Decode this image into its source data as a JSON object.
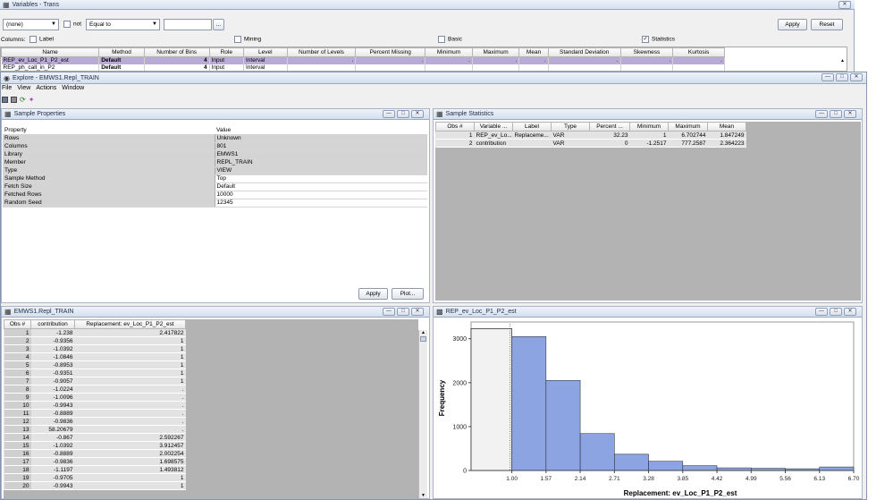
{
  "variables_window": {
    "title": "Variables - Trans",
    "filter": {
      "column_select": "(none)",
      "not_label": "not",
      "operator_select": "Equal to",
      "value": "",
      "ellipsis": "...",
      "apply": "Apply",
      "reset": "Reset"
    },
    "columns_label": "Columns:",
    "checkboxes": [
      {
        "label": "Label",
        "checked": false
      },
      {
        "label": "Mining",
        "checked": false
      },
      {
        "label": "Basic",
        "checked": false
      },
      {
        "label": "Statistics",
        "checked": true
      }
    ],
    "headers": [
      "Name",
      "Method",
      "Number of Bins",
      "Role",
      "Level",
      "Number of Levels",
      "Percent Missing",
      "Minimum",
      "Maximum",
      "Mean",
      "Standard Deviation",
      "Skewness",
      "Kurtosis"
    ],
    "rows": [
      [
        "REP_ev_Loc_P1_P2_est",
        "Default",
        "4",
        "Input",
        "Interval",
        ".",
        ".",
        ".",
        ".",
        ".",
        ".",
        ".",
        "."
      ],
      [
        "REP_ph_call_in_P2",
        "Default",
        "4",
        "Input",
        "Interval",
        "",
        "",
        "",
        "",
        "",
        "",
        "",
        ""
      ]
    ]
  },
  "explore_window": {
    "title": "Explore - EMWS1.Repl_TRAIN",
    "menu": [
      "File",
      "View",
      "Actions",
      "Window"
    ]
  },
  "sample_properties": {
    "title": "Sample Properties",
    "headers": [
      "Property",
      "Value"
    ],
    "rows": [
      [
        "Rows",
        "Unknown"
      ],
      [
        "Columns",
        "801"
      ],
      [
        "Library",
        "EMWS1"
      ],
      [
        "Member",
        "REPL_TRAIN"
      ],
      [
        "Type",
        "VIEW"
      ],
      [
        "Sample Method",
        "Top"
      ],
      [
        "Fetch Size",
        "Default"
      ],
      [
        "Fetched Rows",
        "10000"
      ],
      [
        "Random Seed",
        "12345"
      ]
    ],
    "apply": "Apply",
    "plot": "Plot..."
  },
  "sample_statistics": {
    "title": "Sample Statistics",
    "headers": [
      "Obs #",
      "Variable ...",
      "Label",
      "Type",
      "Percent ...",
      "Minimum",
      "Maximum",
      "Mean"
    ],
    "rows": [
      [
        "1",
        "REP_ev_Lo...",
        "Replaceme...",
        "VAR",
        "32.23",
        "1",
        "6.702744",
        "1.847249"
      ],
      [
        "2",
        "contribution",
        "",
        "VAR",
        "0",
        "-1.2517",
        "777.2587",
        "2.364223"
      ]
    ]
  },
  "data_table": {
    "title": "EMWS1.Repl_TRAIN",
    "headers": [
      "Obs #",
      "contribution",
      "Replacement: ev_Loc_P1_P2_est"
    ],
    "rows": [
      [
        "1",
        "-1.238",
        "2.417822"
      ],
      [
        "2",
        "-0.9356",
        "1"
      ],
      [
        "3",
        "-1.0392",
        "1"
      ],
      [
        "4",
        "-1.0846",
        "1"
      ],
      [
        "5",
        "-0.8953",
        "1"
      ],
      [
        "6",
        "-0.9351",
        "1"
      ],
      [
        "7",
        "-0.9057",
        "1"
      ],
      [
        "8",
        "-1.0224",
        "."
      ],
      [
        "9",
        "-1.0096",
        "."
      ],
      [
        "10",
        "-0.9943",
        "."
      ],
      [
        "11",
        "-0.8889",
        "."
      ],
      [
        "12",
        "-0.9836",
        "."
      ],
      [
        "13",
        "58.20679",
        "."
      ],
      [
        "14",
        "-0.867",
        "2.592267"
      ],
      [
        "15",
        "-1.0392",
        "3.912457"
      ],
      [
        "16",
        "-0.8889",
        "2.002254"
      ],
      [
        "17",
        "-0.9836",
        "1.698575"
      ],
      [
        "18",
        "-1.1197",
        "1.493812"
      ],
      [
        "19",
        "-0.9705",
        "1"
      ],
      [
        "20",
        "-0.9943",
        "1"
      ]
    ]
  },
  "histogram_window": {
    "title": "REP_ev_Loc_P1_P2_est"
  },
  "chart_data": {
    "type": "bar",
    "xlabel": "Replacement: ev_Loc_P1_P2_est",
    "ylabel": "Frequency",
    "x_ticks": [
      "1.00",
      "1.57",
      "2.14",
      "2.71",
      "3.28",
      "3.85",
      "4.42",
      "4.99",
      "5.56",
      "6.13",
      "6.70"
    ],
    "y_ticks": [
      "0",
      "1000",
      "2000",
      "3000"
    ],
    "ylim": [
      0,
      3300
    ],
    "bins": [
      {
        "from": 0.32,
        "to": 1.0,
        "value": 3230,
        "selected": true
      },
      {
        "from": 1.0,
        "to": 1.57,
        "value": 3050
      },
      {
        "from": 1.57,
        "to": 2.14,
        "value": 2050
      },
      {
        "from": 2.14,
        "to": 2.71,
        "value": 840
      },
      {
        "from": 2.71,
        "to": 3.28,
        "value": 370
      },
      {
        "from": 3.28,
        "to": 3.85,
        "value": 210
      },
      {
        "from": 3.85,
        "to": 4.42,
        "value": 110
      },
      {
        "from": 4.42,
        "to": 4.99,
        "value": 60
      },
      {
        "from": 4.99,
        "to": 5.56,
        "value": 50
      },
      {
        "from": 5.56,
        "to": 6.13,
        "value": 40
      },
      {
        "from": 6.13,
        "to": 6.7,
        "value": 80
      }
    ],
    "colors": {
      "bar": "#8da4e3",
      "selected": "#f2f2f2",
      "edge": "#1f1f1f"
    }
  }
}
